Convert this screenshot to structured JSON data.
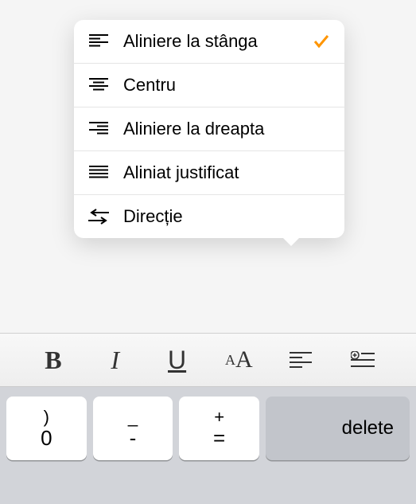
{
  "menu": {
    "items": [
      {
        "label": "Aliniere la stânga",
        "selected": true
      },
      {
        "label": "Centru",
        "selected": false
      },
      {
        "label": "Aliniere la dreapta",
        "selected": false
      },
      {
        "label": "Aliniat justificat",
        "selected": false
      },
      {
        "label": "Direcție",
        "selected": false
      }
    ]
  },
  "toolbar": {
    "bold": "B",
    "italic": "I",
    "underline": "U",
    "textsize": "A",
    "textsize_small": "A"
  },
  "keyboard": {
    "key1_top": ")",
    "key1_bottom": "0",
    "key2_top": "_",
    "key2_bottom": "-",
    "key3_top": "+",
    "key3_bottom": "=",
    "delete": "delete"
  },
  "colors": {
    "accent": "#ff9500"
  }
}
